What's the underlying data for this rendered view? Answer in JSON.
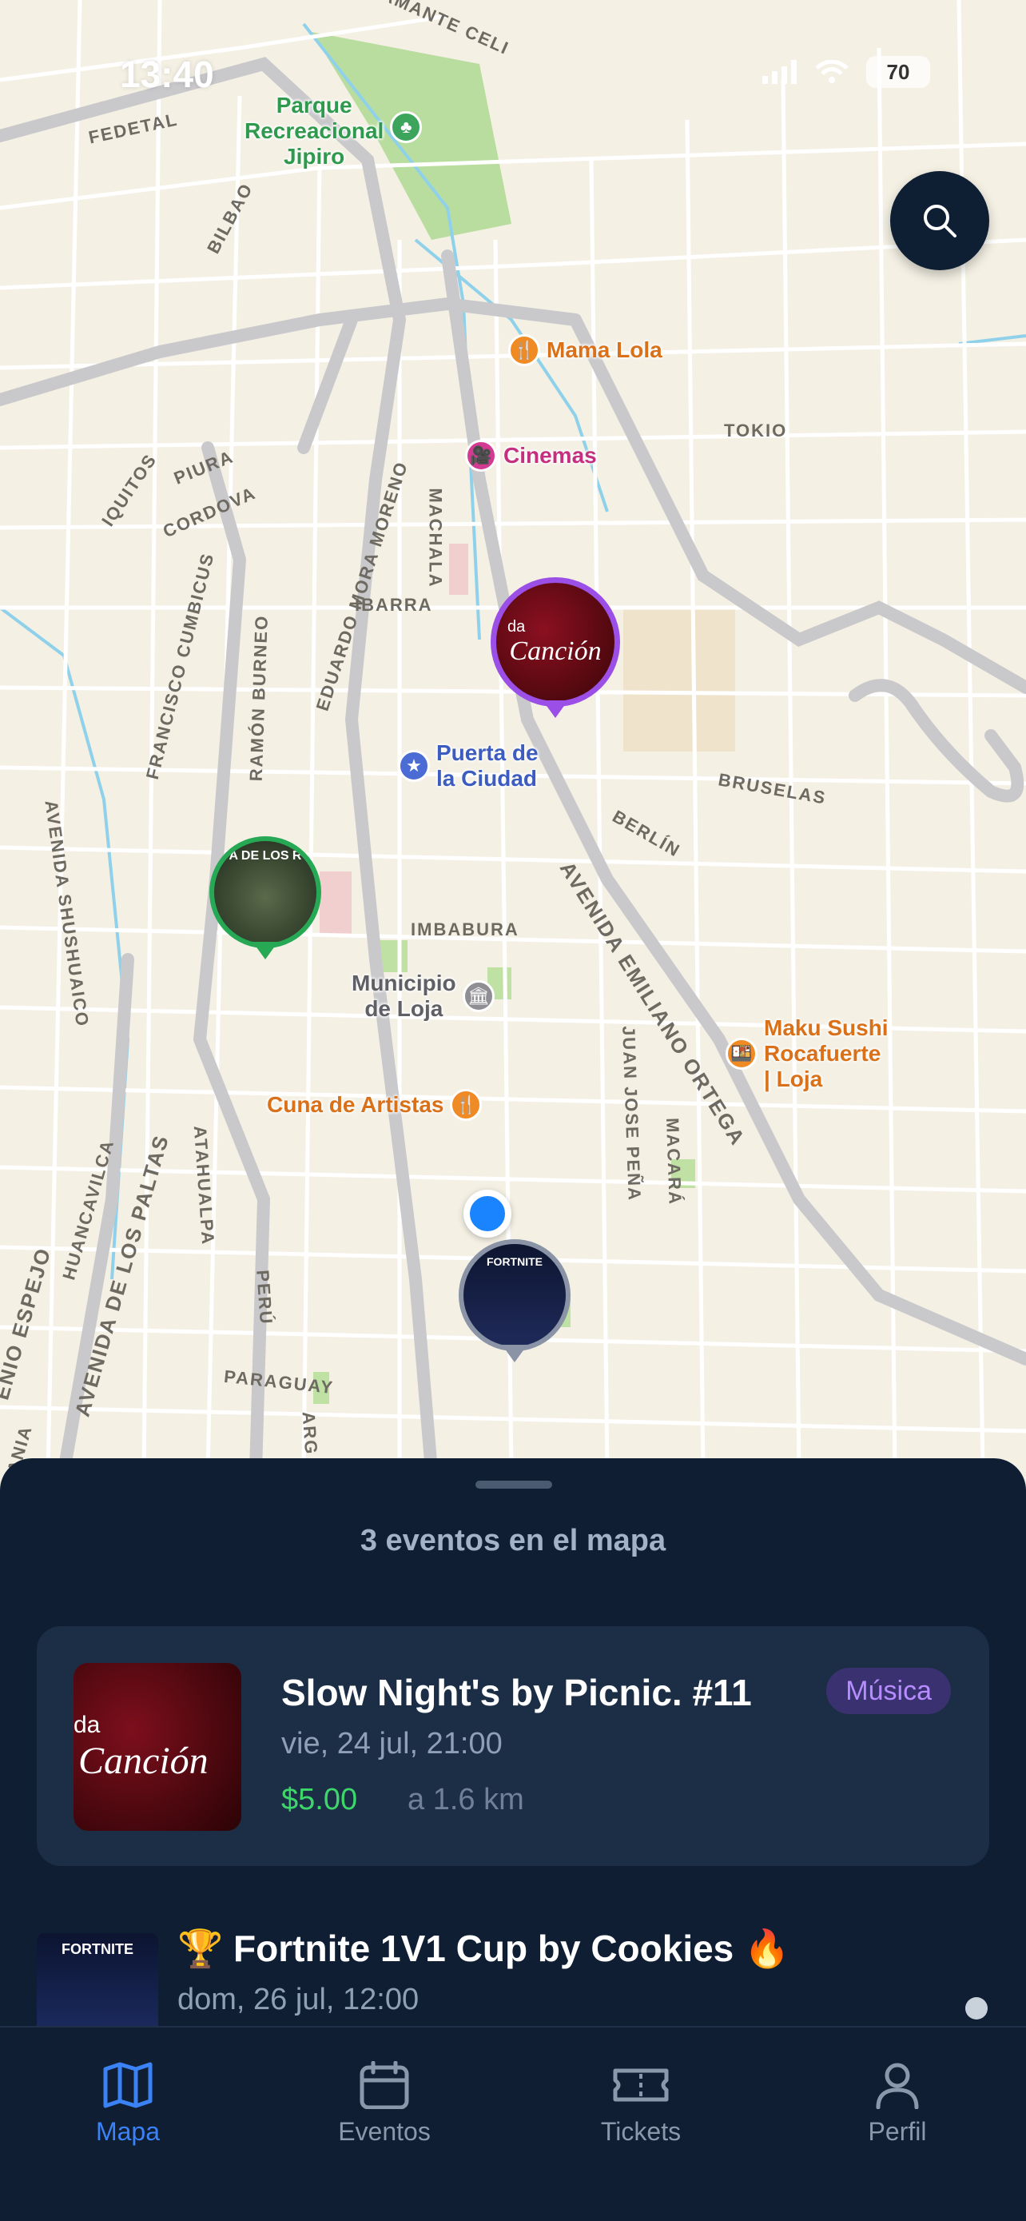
{
  "status_bar": {
    "time": "13:40",
    "battery": "70"
  },
  "map": {
    "street_labels": [
      "STAMANTE CELI",
      "FEDETAL",
      "BILBAO",
      "TOKIO",
      "IQUITOS",
      "PIURA",
      "CORDOVA",
      "EDUARDO MORA MORENO",
      "MACHALA",
      "IBARRA",
      "FRANCISCO CUMBICUS",
      "RAMÓN BURNEO",
      "BRUSELAS",
      "BERLÍN",
      "AVENIDA SHUSHUAICO",
      "IMBABURA",
      "AVENIDA EMILIANO ORTEGA",
      "JUAN JOSE PEÑA",
      "MACARÁ",
      "ATAHUALPA",
      "HUANCAVILCA",
      "AVENIDA DE LOS PALTAS",
      "ENIO ESPEJO",
      "PERÚ",
      "PARAGUAY",
      "ARG",
      "ANIA"
    ],
    "pois": [
      {
        "name": "Parque\nRecreacional\nJipiro",
        "icon": "tree-icon",
        "color": "#3da55b"
      },
      {
        "name": "Mama Lola",
        "icon": "fork-knife-icon",
        "color": "#f08a24"
      },
      {
        "name": "Cinemas",
        "icon": "film-camera-icon",
        "color": "#d33a92"
      },
      {
        "name": "Puerta de\nla Ciudad",
        "icon": "star-icon",
        "color": "#4a6cd4"
      },
      {
        "name": "Municipio\nde Loja",
        "icon": "building-icon",
        "color": "#8e8e93"
      },
      {
        "name": "Cuna de Artistas",
        "icon": "fork-knife-icon",
        "color": "#f08a24"
      },
      {
        "name": "Maku Sushi\nRocafuerte\n| Loja",
        "icon": "food-bowl-icon",
        "color": "#f08a24"
      }
    ],
    "pin_thumb_texts": {
      "cancion_small": "da",
      "cancion_big": "Canción",
      "forest": "A DE LOS R",
      "fortnite": "FORTNITE"
    }
  },
  "sheet": {
    "title": "3 eventos en el mapa",
    "featured": {
      "title": "Slow Night's by Picnic. #11",
      "category": "Música",
      "date": "vie, 24 jul, 21:00",
      "price": "$5.00",
      "distance": "a 1.6 km",
      "thumb_small": "da",
      "thumb_big": "Canción"
    },
    "second": {
      "title": "🏆 Fortnite 1V1 Cup by Cookies 🔥",
      "date": "dom, 26 jul, 12:00",
      "thumb_text": "FORTNITE"
    }
  },
  "tabs": [
    {
      "label": "Mapa",
      "icon": "map-icon",
      "active": true
    },
    {
      "label": "Eventos",
      "icon": "calendar-icon",
      "active": false
    },
    {
      "label": "Tickets",
      "icon": "ticket-icon",
      "active": false
    },
    {
      "label": "Perfil",
      "icon": "person-icon",
      "active": false
    }
  ],
  "colors": {
    "accent": "#3b82f6",
    "sheet": "#0f1e33",
    "card": "#1c2e46",
    "price": "#3dd66a",
    "tag_text": "#b78cff"
  }
}
